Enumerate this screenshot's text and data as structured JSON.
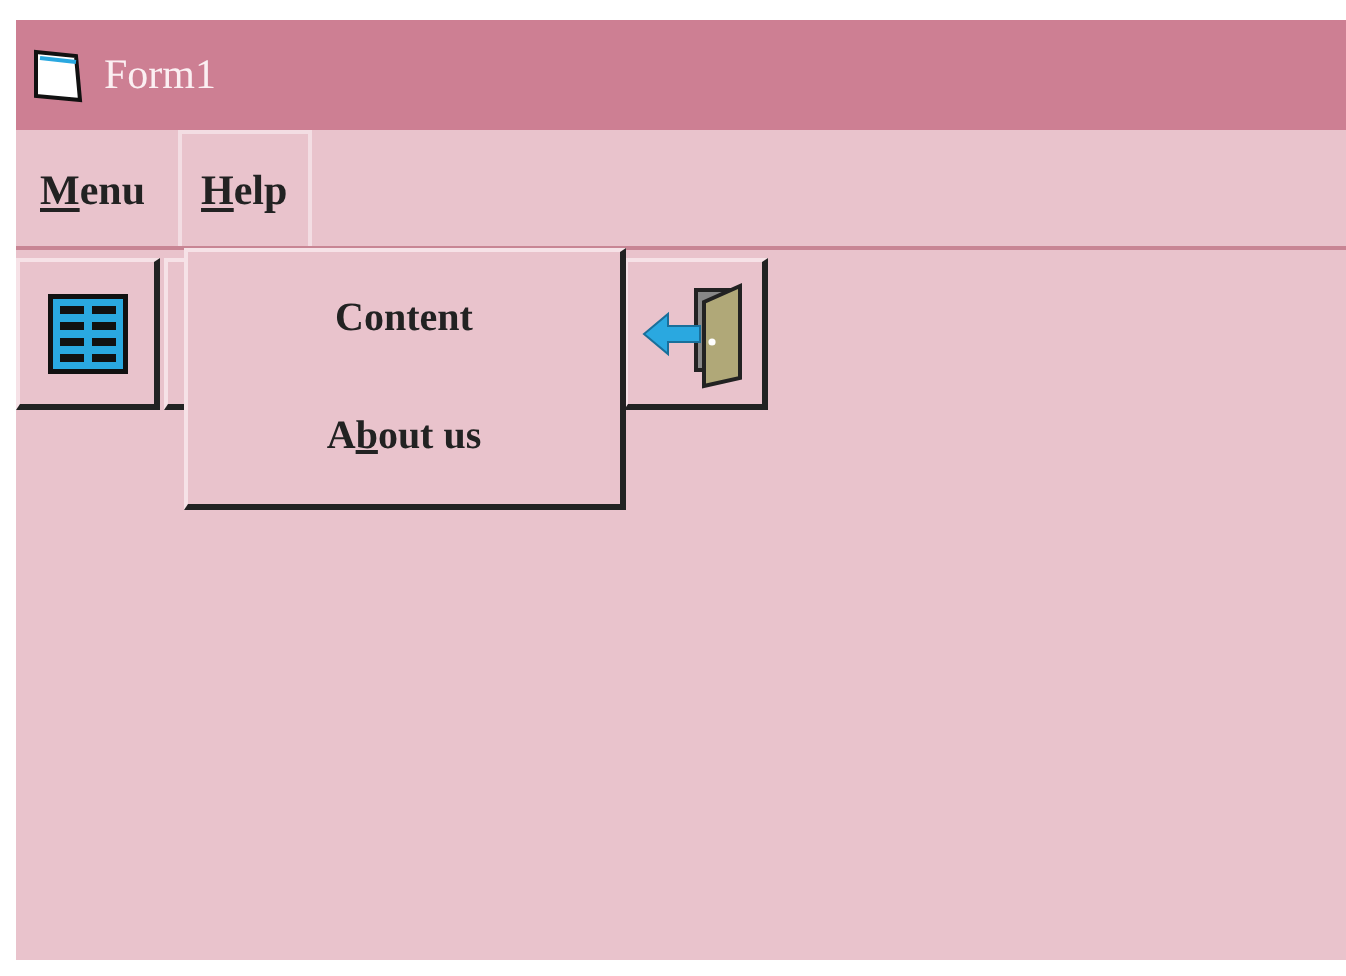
{
  "window": {
    "title": "Form1"
  },
  "menu_bar": [
    {
      "label": [
        {
          "text": "M",
          "underlined": true
        },
        {
          "text": "enu",
          "underlined": false
        }
      ],
      "selected": false
    },
    {
      "label": [
        {
          "text": "H",
          "underlined": true
        },
        {
          "text": "elp",
          "underlined": false
        }
      ],
      "selected": true
    }
  ],
  "toolbar": [
    {
      "kind": "grid"
    },
    {
      "kind": "hidden"
    },
    {
      "kind": "exit"
    }
  ],
  "dropdown": [
    {
      "label": [
        {
          "text": "Content",
          "underlined": false
        }
      ]
    },
    {
      "label": [
        {
          "text": "A",
          "underlined": false
        },
        {
          "text": "b",
          "underlined": true
        },
        {
          "text": "out us",
          "underlined": false
        }
      ]
    }
  ]
}
